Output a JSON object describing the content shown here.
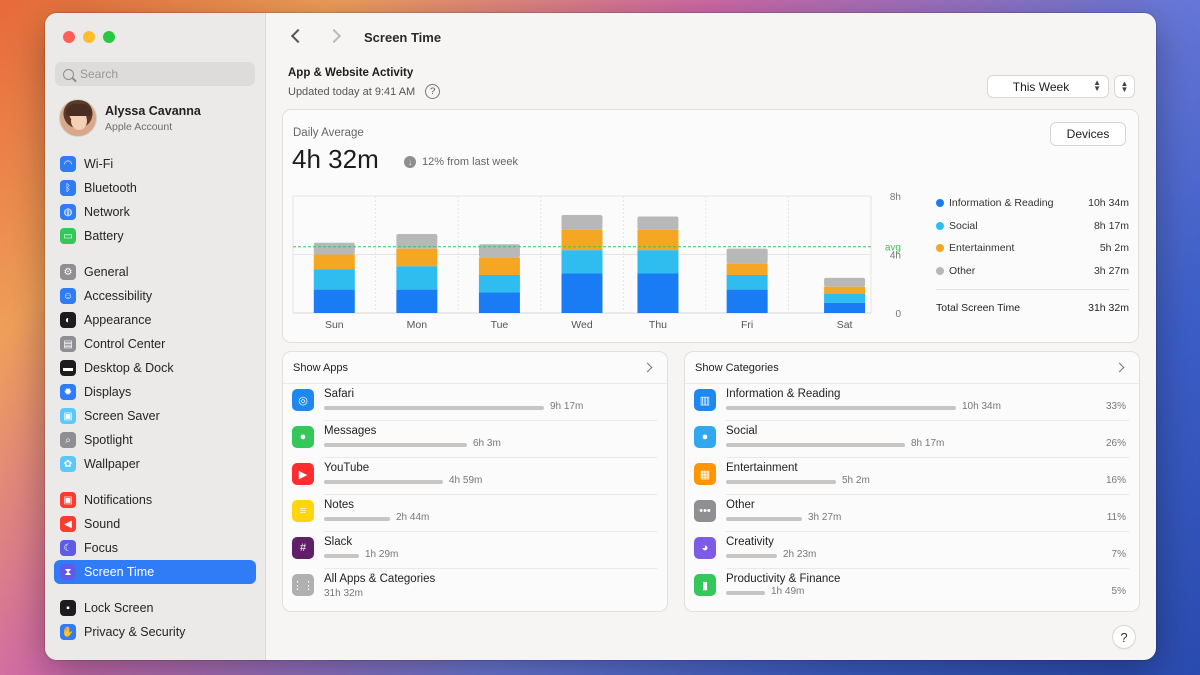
{
  "sidebar": {
    "search_placeholder": "Search",
    "account": {
      "name": "Alyssa Cavanna",
      "subtitle": "Apple Account"
    },
    "groups": [
      [
        {
          "label": "Wi-Fi",
          "icon": "wifi-icon",
          "color": "#2f7cf6",
          "glyph": "◠"
        },
        {
          "label": "Bluetooth",
          "icon": "bluetooth-icon",
          "color": "#2f7cf6",
          "glyph": "ᛒ"
        },
        {
          "label": "Network",
          "icon": "network-icon",
          "color": "#2f7cf6",
          "glyph": "◍"
        },
        {
          "label": "Battery",
          "icon": "battery-icon",
          "color": "#34c759",
          "glyph": "▭"
        }
      ],
      [
        {
          "label": "General",
          "icon": "gear-icon",
          "color": "#8e8e93",
          "glyph": "⚙"
        },
        {
          "label": "Accessibility",
          "icon": "accessibility-icon",
          "color": "#2f7cf6",
          "glyph": "☺"
        },
        {
          "label": "Appearance",
          "icon": "appearance-icon",
          "color": "#1c1c1e",
          "glyph": "◐"
        },
        {
          "label": "Control Center",
          "icon": "control-center-icon",
          "color": "#8e8e93",
          "glyph": "▤"
        },
        {
          "label": "Desktop & Dock",
          "icon": "desktop-dock-icon",
          "color": "#1c1c1e",
          "glyph": "▬"
        },
        {
          "label": "Displays",
          "icon": "displays-icon",
          "color": "#2f7cf6",
          "glyph": "✹"
        },
        {
          "label": "Screen Saver",
          "icon": "screen-saver-icon",
          "color": "#5ac8fa",
          "glyph": "▣"
        },
        {
          "label": "Spotlight",
          "icon": "spotlight-icon",
          "color": "#8e8e93",
          "glyph": "⌕"
        },
        {
          "label": "Wallpaper",
          "icon": "wallpaper-icon",
          "color": "#5ac8fa",
          "glyph": "✿"
        }
      ],
      [
        {
          "label": "Notifications",
          "icon": "notifications-icon",
          "color": "#ff3b30",
          "glyph": "▣"
        },
        {
          "label": "Sound",
          "icon": "sound-icon",
          "color": "#ff3b30",
          "glyph": "◀"
        },
        {
          "label": "Focus",
          "icon": "focus-icon",
          "color": "#5e5ce6",
          "glyph": "☾"
        },
        {
          "label": "Screen Time",
          "icon": "hourglass-icon",
          "color": "#5e5ce6",
          "glyph": "⧗",
          "active": true
        }
      ],
      [
        {
          "label": "Lock Screen",
          "icon": "lock-screen-icon",
          "color": "#1c1c1e",
          "glyph": "▪"
        },
        {
          "label": "Privacy & Security",
          "icon": "privacy-hand-icon",
          "color": "#2f7cf6",
          "glyph": "✋"
        }
      ]
    ]
  },
  "toolbar": {
    "title": "Screen Time"
  },
  "activity": {
    "title": "App & Website Activity",
    "updated": "Updated today at 9:41 AM",
    "help": "?",
    "period": "This Week"
  },
  "summary": {
    "label": "Daily Average",
    "value": "4h 32m",
    "delta": "12% from last week",
    "devices_label": "Devices"
  },
  "chart_data": {
    "type": "bar",
    "stacked": true,
    "categories": [
      "Sun",
      "Mon",
      "Tue",
      "Wed",
      "Thu",
      "Fri",
      "Sat"
    ],
    "y_ticks": [
      "8h",
      "4h",
      "0"
    ],
    "ylim": [
      0,
      8
    ],
    "average_label": "avg",
    "average_value": 4.53,
    "series": [
      {
        "name": "Information & Reading",
        "color": "#1a7cf5",
        "values": [
          1.6,
          1.6,
          1.4,
          2.7,
          2.7,
          1.6,
          0.7
        ]
      },
      {
        "name": "Social",
        "color": "#2fbdf0",
        "values": [
          1.4,
          1.6,
          1.2,
          1.6,
          1.6,
          1.0,
          0.6
        ]
      },
      {
        "name": "Entertainment",
        "color": "#f5a623",
        "values": [
          1.0,
          1.2,
          1.2,
          1.4,
          1.4,
          0.8,
          0.5
        ]
      },
      {
        "name": "Other",
        "color": "#b8b8b8",
        "values": [
          0.8,
          1.0,
          0.9,
          1.0,
          0.9,
          1.0,
          0.6
        ]
      }
    ],
    "legend_totals": [
      "10h 34m",
      "8h 17m",
      "5h 2m",
      "3h 27m"
    ],
    "total_label": "Total Screen Time",
    "total_value": "31h 32m"
  },
  "apps": {
    "header": "Show Apps",
    "rows": [
      {
        "name": "Safari",
        "time": "9h 17m",
        "fraction": 1.0,
        "icon": "safari-icon",
        "color": "#1e88f0",
        "glyph": "◎"
      },
      {
        "name": "Messages",
        "time": "6h 3m",
        "fraction": 0.65,
        "icon": "messages-icon",
        "color": "#34c759",
        "glyph": "●"
      },
      {
        "name": "YouTube",
        "time": "4h 59m",
        "fraction": 0.54,
        "icon": "youtube-icon",
        "color": "#ff2d2d",
        "glyph": "▶"
      },
      {
        "name": "Notes",
        "time": "2h 44m",
        "fraction": 0.3,
        "icon": "notes-icon",
        "color": "#ffd60a",
        "glyph": "≡"
      },
      {
        "name": "Slack",
        "time": "1h 29m",
        "fraction": 0.16,
        "icon": "slack-icon",
        "color": "#611f69",
        "glyph": "#"
      },
      {
        "name": "All Apps & Categories",
        "time": "31h 32m",
        "icon": "grid-icon",
        "color": "#b0b0b0",
        "glyph": "⋮⋮"
      }
    ]
  },
  "categories": {
    "header": "Show Categories",
    "rows": [
      {
        "name": "Information & Reading",
        "time": "10h 34m",
        "pct": "33%",
        "fraction": 1.0,
        "icon": "book-icon",
        "color": "#1e88f0",
        "glyph": "▥"
      },
      {
        "name": "Social",
        "time": "8h 17m",
        "pct": "26%",
        "fraction": 0.78,
        "icon": "chat-bubbles-icon",
        "color": "#2fa8f0",
        "glyph": "●"
      },
      {
        "name": "Entertainment",
        "time": "5h 2m",
        "pct": "16%",
        "fraction": 0.48,
        "icon": "clapper-icon",
        "color": "#ff9500",
        "glyph": "▦"
      },
      {
        "name": "Other",
        "time": "3h 27m",
        "pct": "11%",
        "fraction": 0.33,
        "icon": "ellipsis-icon",
        "color": "#8e8e93",
        "glyph": "•••"
      },
      {
        "name": "Creativity",
        "time": "2h 23m",
        "pct": "7%",
        "fraction": 0.22,
        "icon": "palette-icon",
        "color": "#7d5be6",
        "glyph": "◕"
      },
      {
        "name": "Productivity & Finance",
        "time": "1h 49m",
        "pct": "5%",
        "fraction": 0.17,
        "icon": "chart-icon",
        "color": "#34c759",
        "glyph": "▮"
      }
    ]
  },
  "help_button": "?"
}
